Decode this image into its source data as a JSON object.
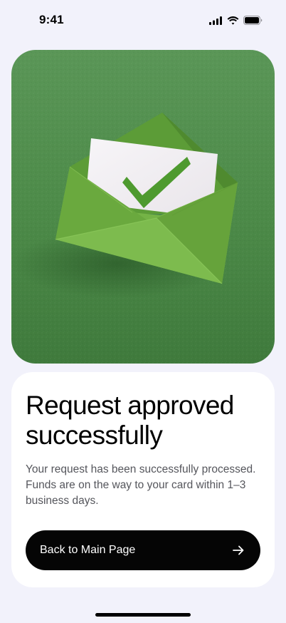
{
  "status_bar": {
    "time": "9:41",
    "icons": [
      "cellular-signal-icon",
      "wifi-icon",
      "battery-icon"
    ]
  },
  "hero": {
    "image": "green-envelope-checkmark-illustration"
  },
  "card": {
    "title": "Request approved successfully",
    "description": "Your request has been successfully processed. Funds are on the way to your card within 1–3 business days.",
    "button_label": "Back to Main Page",
    "button_icon": "arrow-right-icon"
  },
  "colors": {
    "page_background": "#f2f2fb",
    "card_background": "#ffffff",
    "button_background": "#050505",
    "button_text": "#ffffff",
    "description_text": "#55565c",
    "hero_green": "#4f8f4a",
    "envelope_green": "#6fb145"
  }
}
